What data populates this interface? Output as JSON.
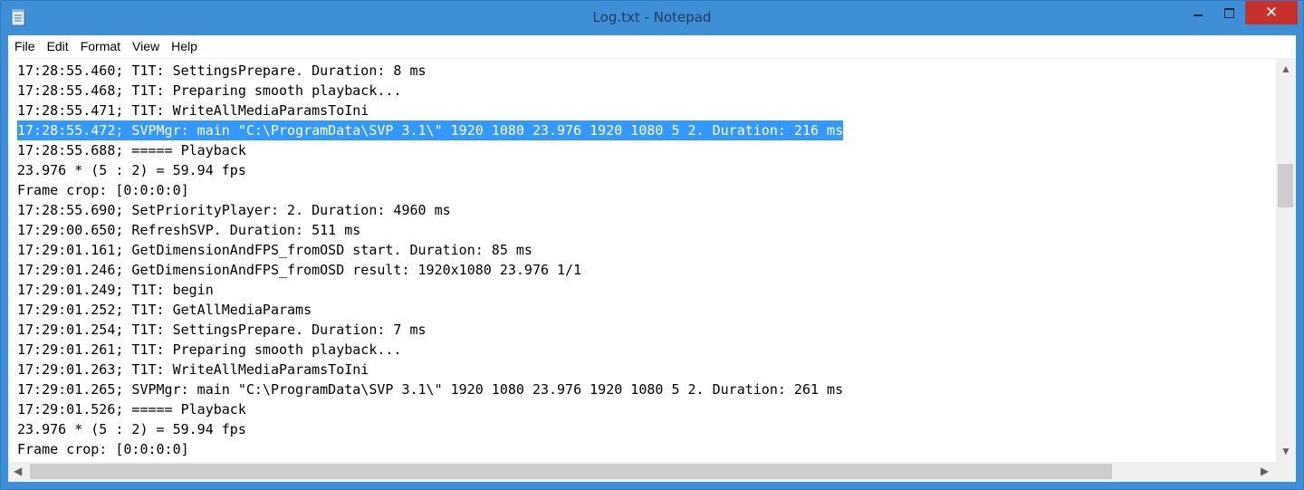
{
  "window": {
    "title": "Log.txt - Notepad",
    "controls": {
      "minimize": "—",
      "maximize": "☐",
      "close": "✕"
    }
  },
  "menu": [
    "File",
    "Edit",
    "Format",
    "View",
    "Help"
  ],
  "editor": {
    "selected_line_index": 3,
    "lines": [
      "17:28:55.460; T1T: SettingsPrepare. Duration: 8 ms",
      "17:28:55.468; T1T: Preparing smooth playback...",
      "17:28:55.471; T1T: WriteAllMediaParamsToIni",
      "17:28:55.472; SVPMgr: main \"C:\\ProgramData\\SVP 3.1\\\" 1920 1080 23.976 1920 1080 5 2. Duration: 216 ms",
      "17:28:55.688; ===== Playback",
      "23.976 * (5 : 2) = 59.94 fps",
      "Frame crop: [0:0:0:0]",
      "17:28:55.690; SetPriorityPlayer: 2. Duration: 4960 ms",
      "17:29:00.650; RefreshSVP. Duration: 511 ms",
      "17:29:01.161; GetDimensionAndFPS_fromOSD start. Duration: 85 ms",
      "17:29:01.246; GetDimensionAndFPS_fromOSD result: 1920x1080 23.976 1/1",
      "17:29:01.249; T1T: begin",
      "17:29:01.252; T1T: GetAllMediaParams",
      "17:29:01.254; T1T: SettingsPrepare. Duration: 7 ms",
      "17:29:01.261; T1T: Preparing smooth playback...",
      "17:29:01.263; T1T: WriteAllMediaParamsToIni",
      "17:29:01.265; SVPMgr: main \"C:\\ProgramData\\SVP 3.1\\\" 1920 1080 23.976 1920 1080 5 2. Duration: 261 ms",
      "17:29:01.526; ===== Playback",
      "23.976 * (5 : 2) = 59.94 fps",
      "Frame crop: [0:0:0:0]"
    ]
  },
  "scrollbars": {
    "vertical_position": 0.26,
    "horizontal_position": 0.0
  },
  "colors": {
    "frame": "#3f8fd6",
    "close_button": "#c7302b",
    "selection": "#3399ff"
  }
}
